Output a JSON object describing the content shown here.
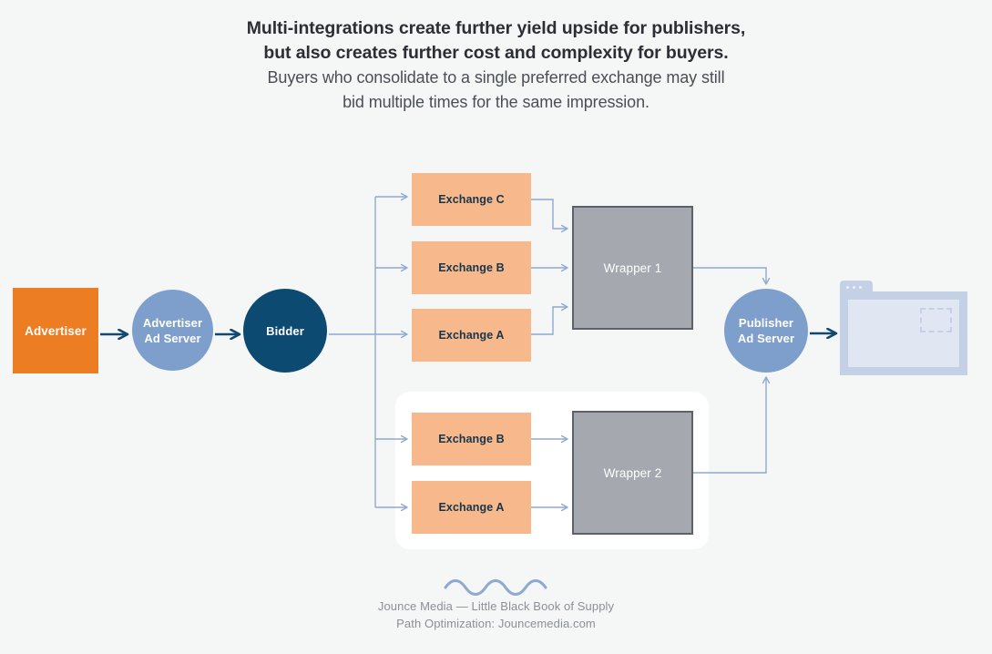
{
  "header": {
    "line1": "Multi-integrations create further yield upside for publishers,",
    "line2": "but also creates further cost and complexity for buyers.",
    "line3": "Buyers who consolidate to a single preferred exchange may still",
    "line4": "bid multiple times for the same impression."
  },
  "nodes": {
    "advertiser": "Advertiser",
    "advertiser_ad_server_line1": "Advertiser",
    "advertiser_ad_server_line2": "Ad Server",
    "bidder": "Bidder",
    "publisher_ad_server_line1": "Publisher",
    "publisher_ad_server_line2": "Ad Server"
  },
  "exchanges_group1": [
    {
      "label": "Exchange C"
    },
    {
      "label": "Exchange B"
    },
    {
      "label": "Exchange A"
    }
  ],
  "exchanges_group2": [
    {
      "label": "Exchange B"
    },
    {
      "label": "Exchange A"
    }
  ],
  "wrappers": {
    "wrapper1": "Wrapper 1",
    "wrapper2": "Wrapper 2"
  },
  "footer": {
    "line1": "Jounce Media — Little Black Book of Supply",
    "line2": "Path Optimization: Jouncemedia.com"
  },
  "colors": {
    "background": "#f5f6f6",
    "orange": "#ed7d22",
    "peach": "#f7b98c",
    "light_blue": "#7e9fcb",
    "dark_navy": "#0d4a72",
    "gray": "#a5a8ae",
    "gray_border": "#5c6069",
    "connector_blue": "#8fa9cf",
    "panel_white": "#ffffff",
    "browser_blue": "#c3d0e6",
    "browser_screen": "#e0e7f2",
    "text_dark": "#2b2f33",
    "text_muted": "#8b9097"
  },
  "icons": {
    "squiggle": "squiggle-divider-icon",
    "browser": "browser-window-icon",
    "ad_slot": "ad-slot-icon"
  }
}
